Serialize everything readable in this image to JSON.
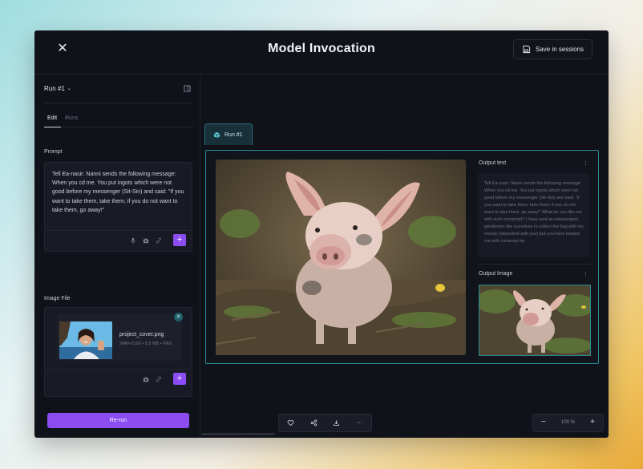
{
  "window": {
    "title": "Model Invocation",
    "save_label": "Save in sessions"
  },
  "left_panel": {
    "run_selector": "Run #1",
    "tabs": [
      {
        "label": "Edit",
        "active": true
      },
      {
        "label": "Runs",
        "active": false
      }
    ],
    "prompt": {
      "label": "Prompt",
      "text": "Tell Ea-nasir: Nanni sends the following message: When you cd me. You put ingots which were not good before my messenger (Sit-Sin) and said: \"If you want to take them, take them; if you do not want to take them, go away!\""
    },
    "image_file": {
      "label": "Image File",
      "file_name": "project_cover.png",
      "file_meta": "3840×2160 • 8.5 MB • PNG"
    },
    "rerun_label": "Re-run"
  },
  "canvas": {
    "run_tab_label": "Run #1",
    "output_text_label": "Output text",
    "output_text": "Tell Ea-nasir: Nanni sends the following message: When you cd me. You put ingots which were not good before my messenger (Sit-Sin) and said: \"If you want to take them, take them; if you do not want to take them, go away!\" What do you like me with such contempt? I have sent as messengers gentlemen like ourselves to collect the bag with my money (deposited with you) but you have treated me with contempt by",
    "output_image_label": "Output Image",
    "menu_dots": "⋮",
    "toolbar": [
      "heart-icon",
      "share-icon",
      "download-icon",
      "more-icon"
    ],
    "more_label": "···",
    "zoom": {
      "minus": "−",
      "value": "100 %",
      "plus": "+"
    }
  },
  "colors": {
    "accent": "#8b4df1",
    "teal": "#2b8a96",
    "background": "#10121a"
  }
}
